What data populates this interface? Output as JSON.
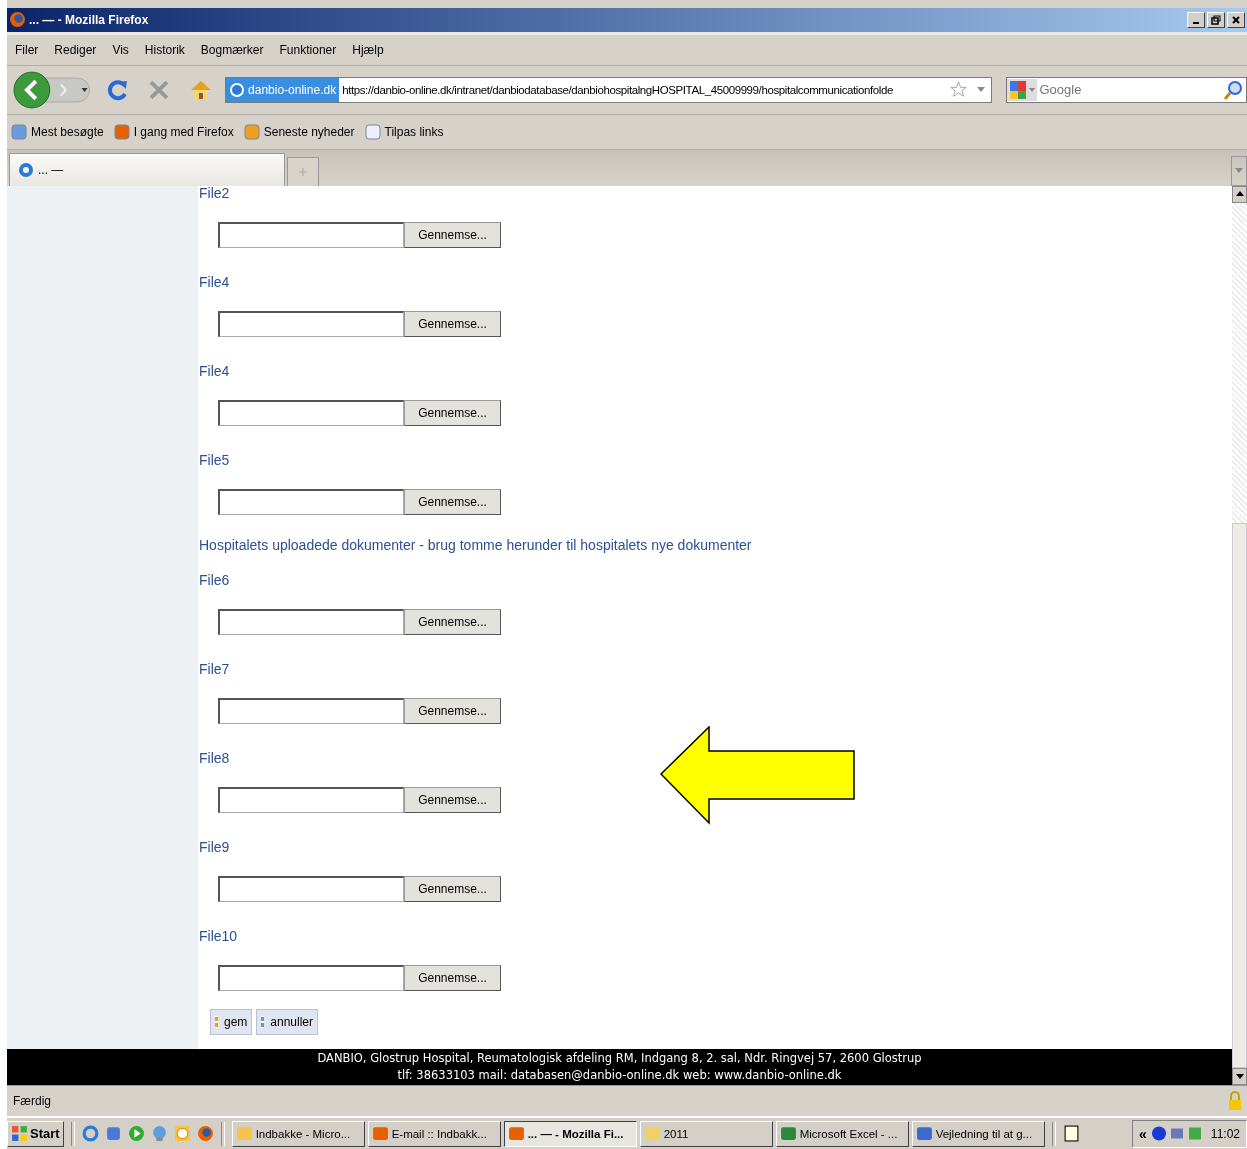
{
  "window": {
    "title": "... — - Mozilla Firefox"
  },
  "menu": [
    "Filer",
    "Rediger",
    "Vis",
    "Historik",
    "Bogmærker",
    "Funktioner",
    "Hjælp"
  ],
  "nav": {
    "site": "danbio-online.dk",
    "url": "https://danbio-online.dk/intranet/danbiodatabase/danbiohospitalngHOSPITAL_45009999/hospitalcommunicationfolde",
    "search_placeholder": "Google"
  },
  "bookmarks": [
    "Mest besøgte",
    "I gang med Firefox",
    "Seneste nyheder",
    "Tilpas links"
  ],
  "tabs": [
    {
      "label": "... —",
      "selected": true
    }
  ],
  "form": [
    {
      "kind": "file",
      "label": "File2",
      "button": "Gennemse..."
    },
    {
      "kind": "file",
      "label": "File4",
      "button": "Gennemse..."
    },
    {
      "kind": "file",
      "label": "File4",
      "button": "Gennemse..."
    },
    {
      "kind": "file",
      "label": "File5",
      "button": "Gennemse..."
    },
    {
      "kind": "heading",
      "text": "Hospitalets uploadede dokumenter - brug tomme herunder til hospitalets nye dokumenter"
    },
    {
      "kind": "file",
      "label": "File6",
      "button": "Gennemse..."
    },
    {
      "kind": "file",
      "label": "File7",
      "button": "Gennemse..."
    },
    {
      "kind": "file",
      "label": "File8",
      "button": "Gennemse..."
    },
    {
      "kind": "file",
      "label": "File9",
      "button": "Gennemse..."
    },
    {
      "kind": "file",
      "label": "File10",
      "button": "Gennemse..."
    }
  ],
  "actions": [
    "gem",
    "annuller"
  ],
  "footer": [
    "DANBIO, Glostrup Hospital, Reumatologisk afdeling RM, Indgang 8, 2. sal, Ndr. Ringvej 57, 2600 Glostrup",
    "tlf: 38633103 mail: databasen@danbio-online.dk web: www.danbio-online.dk"
  ],
  "status_bar": "Færdig",
  "taskbar": {
    "start": "Start",
    "items": [
      {
        "label": "Indbakke - Micro...",
        "selected": false
      },
      {
        "label": "E-mail :: Indbakk...",
        "selected": false
      },
      {
        "label": "... — - Mozilla Fi...",
        "selected": true
      },
      {
        "label": "2011",
        "selected": false
      },
      {
        "label": "Microsoft Excel - ...",
        "selected": false
      },
      {
        "label": "Vejledning til at g...",
        "selected": false
      }
    ],
    "tray_arrow": "«",
    "clock": "11:02"
  }
}
